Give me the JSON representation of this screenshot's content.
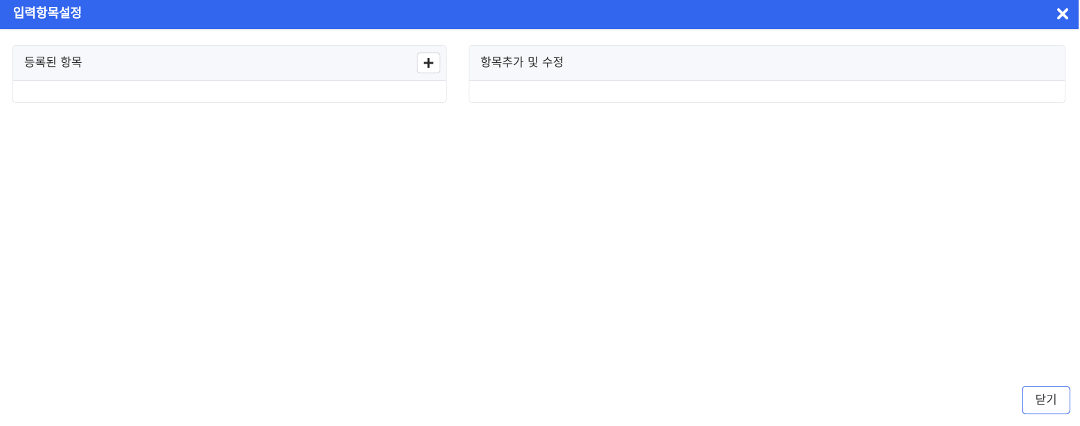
{
  "dialog": {
    "title": "입력항목설정",
    "close_icon": "close-icon",
    "accent_color": "#3366ee"
  },
  "registered_panel": {
    "title": "등록된 항목",
    "add_icon": "plus-icon"
  },
  "edit_panel": {
    "title": "항목추가 및 수정"
  },
  "footer": {
    "close_label": "닫기"
  }
}
